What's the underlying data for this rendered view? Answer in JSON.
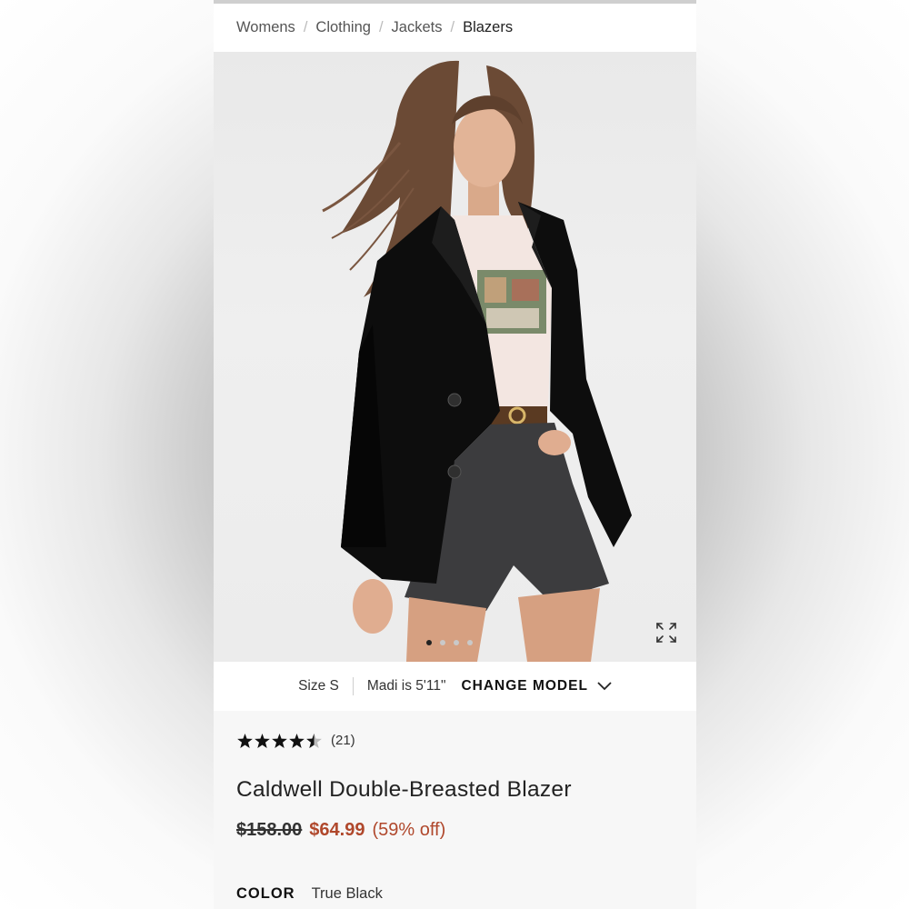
{
  "breadcrumb": {
    "items": [
      {
        "label": "Womens"
      },
      {
        "label": "Clothing"
      },
      {
        "label": "Jackets"
      },
      {
        "label": "Blazers"
      }
    ],
    "separator": "/"
  },
  "gallery": {
    "image_count": 4,
    "active_index": 0,
    "expand_icon": "expand-icon"
  },
  "model_info": {
    "size": "Size S",
    "height": "Madi is 5'11\"",
    "change_model_label": "CHANGE MODEL"
  },
  "product": {
    "rating": 4.5,
    "review_count": "(21)",
    "name": "Caldwell Double-Breasted Blazer",
    "original_price": "$158.00",
    "sale_price": "$64.99",
    "discount": "(59% off)",
    "color_label": "COLOR",
    "color_value": "True Black"
  },
  "colors": {
    "sale": "#b0482c",
    "text": "#222222"
  }
}
